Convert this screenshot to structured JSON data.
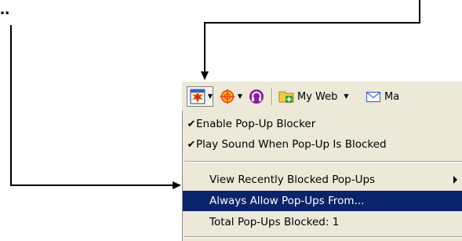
{
  "fragment_text": "..",
  "toolbar": {
    "buttons": [
      {
        "icon": "popup-blocker-icon",
        "has_dropdown": true,
        "pressed": true
      },
      {
        "icon": "target-icon",
        "has_dropdown": true,
        "pressed": false
      },
      {
        "icon": "headphones-icon",
        "has_dropdown": false,
        "pressed": false
      }
    ],
    "my_web_label": "My Web",
    "mail_label": "Ma",
    "colors": {
      "toolbar_bg": "#ece9d8",
      "popup_icon": "#d4272b",
      "target_icon": "#e8412a",
      "headphones_icon": "#8a1ea8"
    }
  },
  "menu": {
    "items": [
      {
        "label": "Enable Pop-Up Blocker",
        "checked": true
      },
      {
        "label": "Play Sound When Pop-Up Is Blocked",
        "checked": true
      },
      {
        "label": "View Recently Blocked Pop-Ups",
        "submenu": true
      },
      {
        "label": "Always Allow Pop-Ups From...",
        "highlighted": true
      },
      {
        "label": "Total Pop-Ups Blocked: 1"
      }
    ],
    "check_glyph": "✔",
    "colors": {
      "highlight_bg": "#0a246a",
      "highlight_text": "#ffffff"
    }
  }
}
